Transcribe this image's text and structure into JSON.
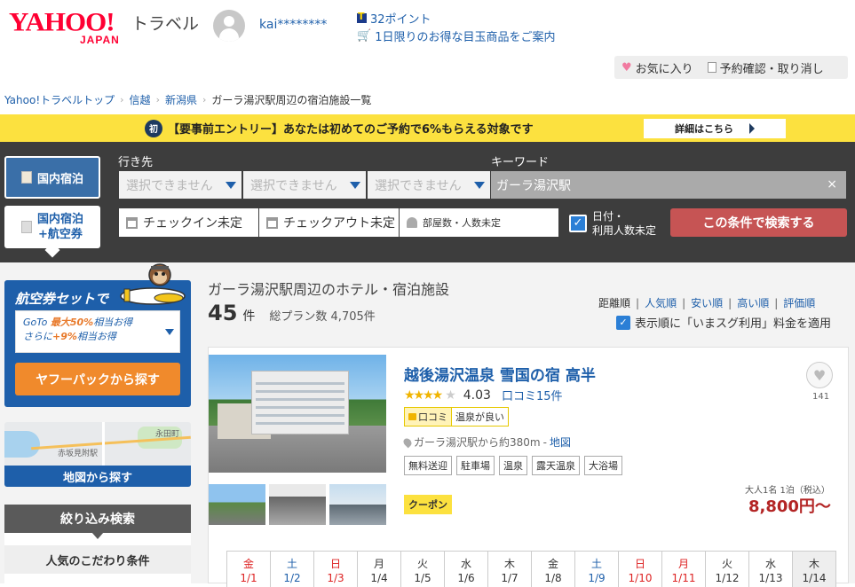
{
  "header": {
    "logo_main": "YAHOO!",
    "logo_sub": "JAPAN",
    "brand": "トラベル",
    "username": "kai********",
    "points": "32ポイント",
    "deal_text": "1日限りのお得な目玉商品をご案内",
    "favorites": "お気に入り",
    "reservation": "予約確認・取り消し"
  },
  "breadcrumb": [
    "Yahoo!トラベルトップ",
    "信越",
    "新潟県",
    "ガーラ湯沢駅周辺の宿泊施設一覧"
  ],
  "banner": {
    "badge": "初",
    "text": "【要事前エントリー】あなたは初めてのご予約で6%もらえる対象です",
    "detail": "詳細はこちら"
  },
  "search": {
    "tab_domestic": "国内宿泊",
    "tab_air_1": "国内宿泊",
    "tab_air_2": "+航空券",
    "dest_label": "行き先",
    "keyword_label": "キーワード",
    "select_placeholder": "選択できません",
    "keyword_value": "ガーラ湯沢駅",
    "clear": "×",
    "checkin": "チェックイン未定",
    "checkout": "チェックアウト未定",
    "rooms": "部屋数・人数未定",
    "nodate_1": "日付・",
    "nodate_2": "利用人数未定",
    "button": "この条件で検索する"
  },
  "sidebar": {
    "air_title": "航空券セットで",
    "goto_line1_a": "GoTo ",
    "goto_line1_b": "最大50%",
    "goto_line1_c": "相当お得",
    "goto_line2_a": "さらに",
    "goto_line2_b": "+9%",
    "goto_line2_c": "相当お得",
    "yahoo_pack": "ヤフーパックから探す",
    "map_place1": "赤坂見附駅",
    "map_place2": "永田町",
    "map_button": "地図から探す",
    "filter_title": "絞り込み検索",
    "filter_sub": "人気のこだわり条件"
  },
  "results": {
    "title": "ガーラ湯沢駅周辺のホテル・宿泊施設",
    "count": "45",
    "count_unit": "件",
    "plans": "総プラン数 4,705件",
    "sort": [
      "距離順",
      "人気順",
      "安い順",
      "高い順",
      "評価順"
    ],
    "imanow": "表示順に「いまスグ利用」料金を適用"
  },
  "hotel": {
    "name": "越後湯沢温泉 雪国の宿 高半",
    "fav_count": "141",
    "rating": 4.03,
    "rating_text": "4.03",
    "reviews": "口コミ15件",
    "review_tag": "口コミ",
    "review_note": "温泉が良い",
    "access": "ガーラ湯沢駅から約380m",
    "access_map": "地図",
    "amenities": [
      "無料送迎",
      "駐車場",
      "温泉",
      "露天温泉",
      "大浴場"
    ],
    "coupon": "クーポン",
    "price_info": "大人1名 1泊（税込）",
    "price": "8,800円〜"
  },
  "calendar": [
    {
      "w": "金",
      "d": "1/1",
      "type": "red"
    },
    {
      "w": "土",
      "d": "1/2",
      "type": "sat"
    },
    {
      "w": "日",
      "d": "1/3",
      "type": "red"
    },
    {
      "w": "月",
      "d": "1/4",
      "type": ""
    },
    {
      "w": "火",
      "d": "1/5",
      "type": ""
    },
    {
      "w": "水",
      "d": "1/6",
      "type": ""
    },
    {
      "w": "木",
      "d": "1/7",
      "type": ""
    },
    {
      "w": "金",
      "d": "1/8",
      "type": ""
    },
    {
      "w": "土",
      "d": "1/9",
      "type": "sat"
    },
    {
      "w": "日",
      "d": "1/10",
      "type": "red"
    },
    {
      "w": "月",
      "d": "1/11",
      "type": "red"
    },
    {
      "w": "火",
      "d": "1/12",
      "type": ""
    },
    {
      "w": "水",
      "d": "1/13",
      "type": ""
    },
    {
      "w": "木",
      "d": "1/14",
      "type": "last"
    }
  ],
  "colors": {
    "brand_red": "#ff0033",
    "link_blue": "#1e5faa",
    "banner_yellow": "#fce13f",
    "search_bg": "#3d3d3d",
    "search_button": "#c65454",
    "price_red": "#b32424"
  }
}
